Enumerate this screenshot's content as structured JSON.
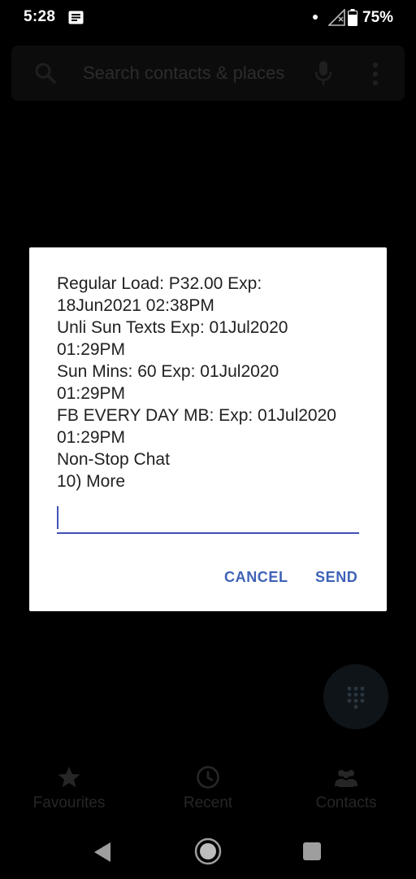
{
  "status_bar": {
    "time": "5:28",
    "battery_percent": "75%",
    "notification_icon": "message-notification-icon",
    "signal_icon": "signal-icon",
    "battery_icon": "battery-icon"
  },
  "search": {
    "placeholder": "Search contacts & places"
  },
  "dialog": {
    "message": "Regular Load: P32.00 Exp:\n18Jun2021 02:38PM\nUnli Sun Texts Exp: 01Jul2020\n01:29PM\nSun Mins: 60 Exp: 01Jul2020\n01:29PM\nFB EVERY DAY MB: Exp: 01Jul2020\n01:29PM\nNon-Stop Chat\n10) More",
    "input_value": "",
    "cancel_label": "CANCEL",
    "send_label": "SEND"
  },
  "bottom_nav": {
    "tabs": [
      {
        "label": "Favourites",
        "icon": "star-icon"
      },
      {
        "label": "Recent",
        "icon": "clock-icon"
      },
      {
        "label": "Contacts",
        "icon": "people-icon"
      }
    ]
  },
  "colors": {
    "accent": "#3f51b5",
    "button_text": "#3f62b8",
    "dialog_background": "#ffffff",
    "screen_background": "#000000"
  }
}
